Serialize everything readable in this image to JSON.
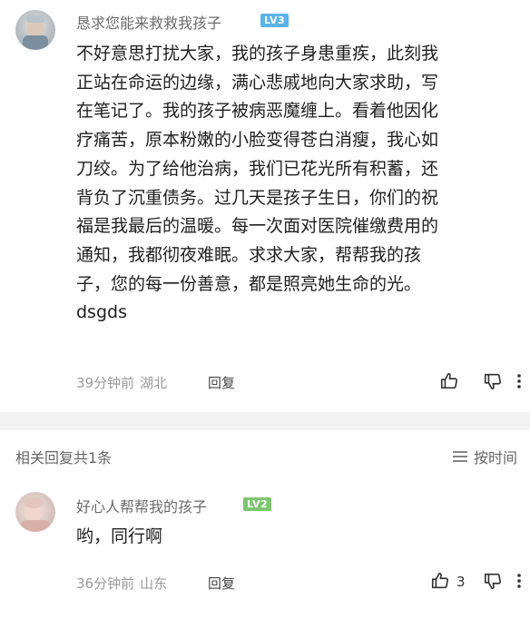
{
  "main_comment": {
    "username": "恳求您能来救救我孩子",
    "level": "LV3",
    "lines": [
      "不好意思打扰大家，我的孩子身患重疾，此刻我",
      "正站在命运的边缘，满心悲戚地向大家求助，写",
      "在笔记了。我的孩子被病恶魔缠上。看着他因化",
      "疗痛苦，原本粉嫩的小脸变得苍白消瘦，我心如",
      "刀绞。为了给他治病，我们已花光所有积蓄，还",
      "背负了沉重债务。过几天是孩子生日，你们的祝",
      "福是我最后的温暖。每一次面对医院催缴费用的",
      "通知，我都彻夜难眠。求求大家，帮帮我的孩",
      "子，您的每一份善意，都是照亮她生命的光。",
      "dsgds"
    ],
    "time": "39分钟前",
    "location": "湖北",
    "reply_label": "回复",
    "like_count": ""
  },
  "replies_header": {
    "count_label": "相关回复共1条",
    "sort_label": "按时间"
  },
  "reply_comment": {
    "username": "好心人帮帮我的孩子",
    "level": "LV2",
    "lines": [
      "哟，同行啊"
    ],
    "time": "36分钟前",
    "location": "山东",
    "reply_label": "回复",
    "like_count": "3"
  },
  "colors": {
    "lv3_badge": "#5bb3e6",
    "lv2_badge": "#7cc66f",
    "meta_text": "#9a9a9a",
    "divider": "#f3f3f3"
  },
  "icons": [
    "avatar",
    "level-badge",
    "thumbs-up-icon",
    "thumbs-down-icon",
    "more-vertical-icon",
    "sort-lines-icon"
  ]
}
